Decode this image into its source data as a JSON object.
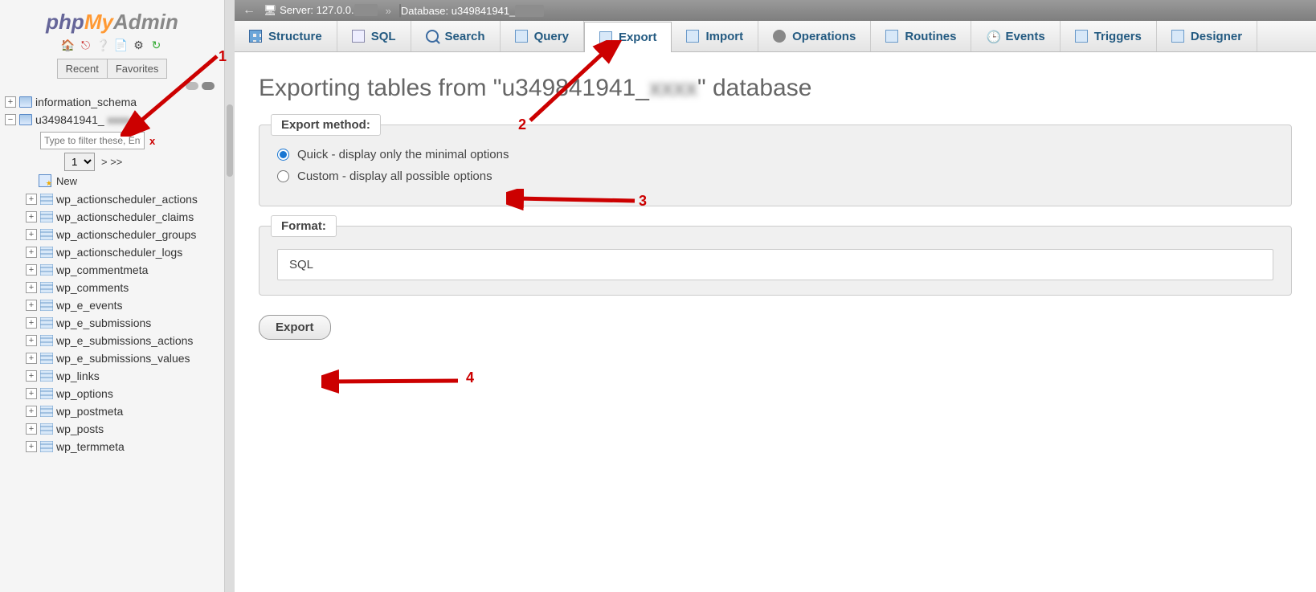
{
  "logo": {
    "p1": "php",
    "p2": "My",
    "p3": "Admin"
  },
  "sidebar": {
    "recent_label": "Recent",
    "favorites_label": "Favorites",
    "db1": "information_schema",
    "db2": "u349841941_",
    "filter_placeholder": "Type to filter these, Enter",
    "filter_x": "x",
    "page_value": "1",
    "page_more": "> >>",
    "new_label": "New",
    "tables": [
      "wp_actionscheduler_actions",
      "wp_actionscheduler_claims",
      "wp_actionscheduler_groups",
      "wp_actionscheduler_logs",
      "wp_commentmeta",
      "wp_comments",
      "wp_e_events",
      "wp_e_submissions",
      "wp_e_submissions_actions",
      "wp_e_submissions_values",
      "wp_links",
      "wp_options",
      "wp_postmeta",
      "wp_posts",
      "wp_termmeta"
    ]
  },
  "breadcrumb": {
    "server_label": "Server: 127.0.0.",
    "database_label": "Database: u349841941_"
  },
  "tabs": {
    "structure": "Structure",
    "sql": "SQL",
    "search": "Search",
    "query": "Query",
    "export": "Export",
    "import": "Import",
    "operations": "Operations",
    "routines": "Routines",
    "events": "Events",
    "triggers": "Triggers",
    "designer": "Designer"
  },
  "page": {
    "title_pre": "Exporting tables from \"u349841941_",
    "title_post": "\" database"
  },
  "export_method": {
    "legend": "Export method:",
    "quick": "Quick - display only the minimal options",
    "custom": "Custom - display all possible options"
  },
  "format": {
    "legend": "Format:",
    "value": "SQL"
  },
  "export_button": "Export",
  "annotations": {
    "n1": "1",
    "n2": "2",
    "n3": "3",
    "n4": "4"
  }
}
